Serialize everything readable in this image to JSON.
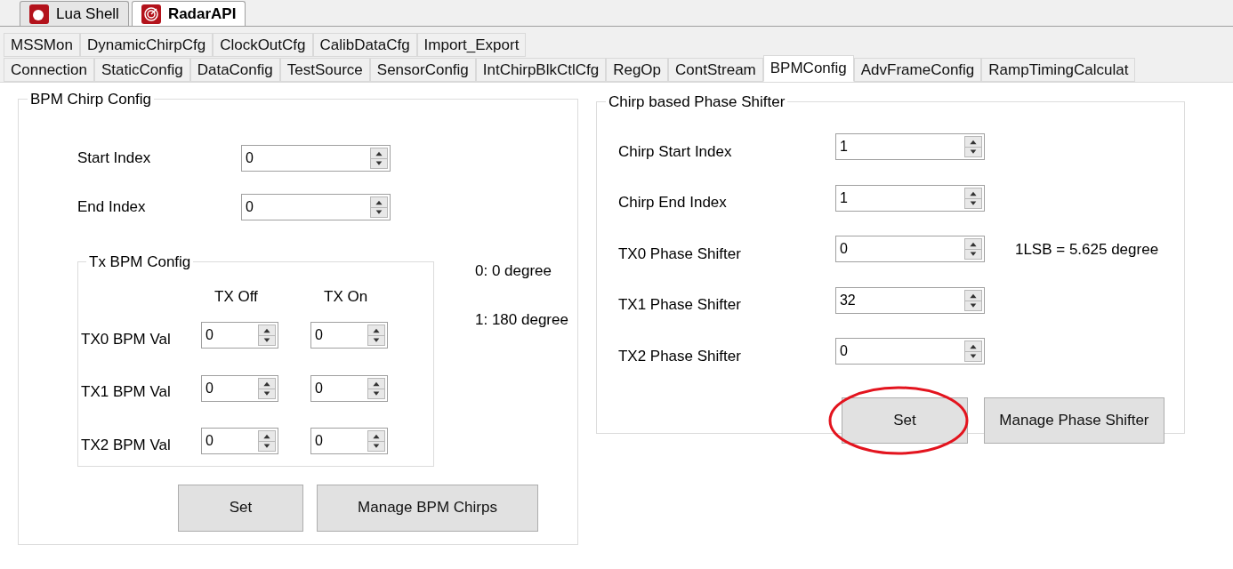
{
  "document_tabs": [
    {
      "label": "Lua Shell",
      "selected": false
    },
    {
      "label": "RadarAPI",
      "selected": true
    }
  ],
  "tab_rows": [
    [
      {
        "label": "MSSMon",
        "selected": false
      },
      {
        "label": "DynamicChirpCfg",
        "selected": false
      },
      {
        "label": "ClockOutCfg",
        "selected": false
      },
      {
        "label": "CalibDataCfg",
        "selected": false
      },
      {
        "label": "Import_Export",
        "selected": false
      }
    ],
    [
      {
        "label": "Connection",
        "selected": false
      },
      {
        "label": "StaticConfig",
        "selected": false
      },
      {
        "label": "DataConfig",
        "selected": false
      },
      {
        "label": "TestSource",
        "selected": false
      },
      {
        "label": "SensorConfig",
        "selected": false
      },
      {
        "label": "IntChirpBlkCtlCfg",
        "selected": false
      },
      {
        "label": "RegOp",
        "selected": false
      },
      {
        "label": "ContStream",
        "selected": false
      },
      {
        "label": "BPMConfig",
        "selected": true
      },
      {
        "label": "AdvFrameConfig",
        "selected": false
      },
      {
        "label": "RampTimingCalculat",
        "selected": false
      }
    ]
  ],
  "bpm_chirp_config": {
    "title": "BPM Chirp Config",
    "fields": [
      {
        "label": "Start Index",
        "value": "0"
      },
      {
        "label": "End Index",
        "value": "0"
      }
    ],
    "tx_bpm_config": {
      "title": "Tx BPM Config",
      "columns": [
        "TX Off",
        "TX On"
      ],
      "rows": [
        {
          "label": "TX0 BPM Val",
          "off": "0",
          "on": "0"
        },
        {
          "label": "TX1 BPM Val",
          "off": "0",
          "on": "0"
        },
        {
          "label": "TX2 BPM Val",
          "off": "0",
          "on": "0"
        }
      ]
    },
    "notes": [
      "0: 0 degree",
      "1: 180 degree"
    ],
    "buttons": [
      {
        "label": "Set",
        "annotated": false
      },
      {
        "label": "Manage BPM Chirps",
        "annotated": false
      }
    ]
  },
  "phase_shifter": {
    "title": "Chirp based Phase Shifter",
    "fields": [
      {
        "label": "Chirp Start Index",
        "value": "1"
      },
      {
        "label": "Chirp End Index",
        "value": "1"
      },
      {
        "label": "TX0 Phase Shifter",
        "value": "0"
      },
      {
        "label": "TX1 Phase Shifter",
        "value": "32"
      },
      {
        "label": "TX2 Phase Shifter",
        "value": "0"
      }
    ],
    "note": "1LSB = 5.625 degree",
    "buttons": [
      {
        "label": "Set",
        "annotated": true
      },
      {
        "label": "Manage Phase Shifter",
        "annotated": false
      }
    ]
  }
}
